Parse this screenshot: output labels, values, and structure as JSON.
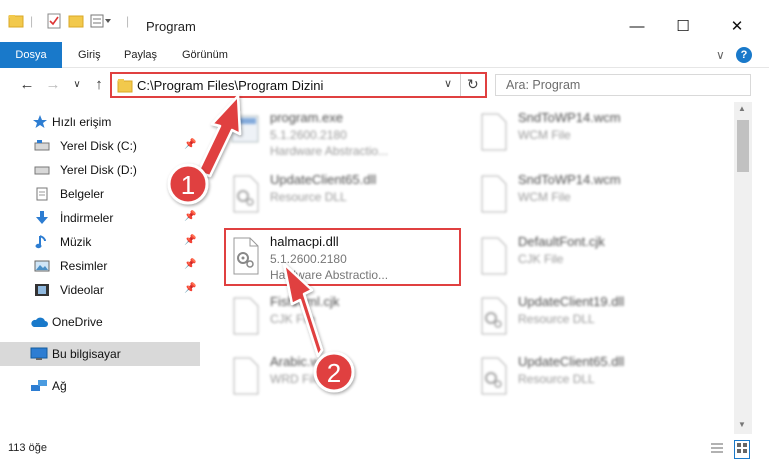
{
  "window": {
    "title": "Program",
    "minimize": "—",
    "maximize": "☐",
    "close": "✕"
  },
  "ribbon": {
    "tabs": [
      "Dosya",
      "Giriş",
      "Paylaş",
      "Görünüm"
    ],
    "collapse": "∨",
    "help": "?"
  },
  "nav": {
    "back": "←",
    "forward": "→",
    "recent": "∨",
    "up": "↑",
    "address": "C:\\Program Files\\Program Dizini",
    "address_dropdown": "∨",
    "refresh": "↻",
    "search_placeholder": "Ara: Program"
  },
  "sidebar": {
    "items": [
      {
        "label": "Hızlı erişim"
      },
      {
        "label": "Yerel Disk (C:)"
      },
      {
        "label": "Yerel Disk (D:)"
      },
      {
        "label": "Belgeler"
      },
      {
        "label": "İndirmeler"
      },
      {
        "label": "Müzik"
      },
      {
        "label": "Resimler"
      },
      {
        "label": "Videolar"
      },
      {
        "label": "OneDrive"
      },
      {
        "label": "Bu bilgisayar"
      },
      {
        "label": "Ağ"
      }
    ]
  },
  "files": [
    {
      "name": "program.exe",
      "line2": "5.1.2600.2180",
      "line3": "Hardware Abstractio..."
    },
    {
      "name": "SndToWP14.wcm",
      "line2": "WCM File",
      "line3": ""
    },
    {
      "name": "UpdateClient65.dll",
      "line2": "Resource DLL",
      "line3": ""
    },
    {
      "name": "SndToWP14.wcm",
      "line2": "WCM File",
      "line3": ""
    },
    {
      "name": "halmacpi.dll",
      "line2": "5.1.2600.2180",
      "line3": "Hardware Abstractio..."
    },
    {
      "name": "DefaultFont.cjk",
      "line2": "CJK File",
      "line3": ""
    },
    {
      "name": "Fishreml.cjk",
      "line2": "CJK File",
      "line3": ""
    },
    {
      "name": "UpdateClient19.dll",
      "line2": "Resource DLL",
      "line3": ""
    },
    {
      "name": "Arabic.wrd",
      "line2": "WRD File",
      "line3": ""
    },
    {
      "name": "UpdateClient65.dll",
      "line2": "Resource DLL",
      "line3": ""
    }
  ],
  "status": {
    "count": "113 öğe"
  },
  "markers": [
    "1",
    "2"
  ],
  "colors": {
    "accent": "#1979ca",
    "highlight": "#e04040",
    "selected": "#d9d9d9"
  }
}
